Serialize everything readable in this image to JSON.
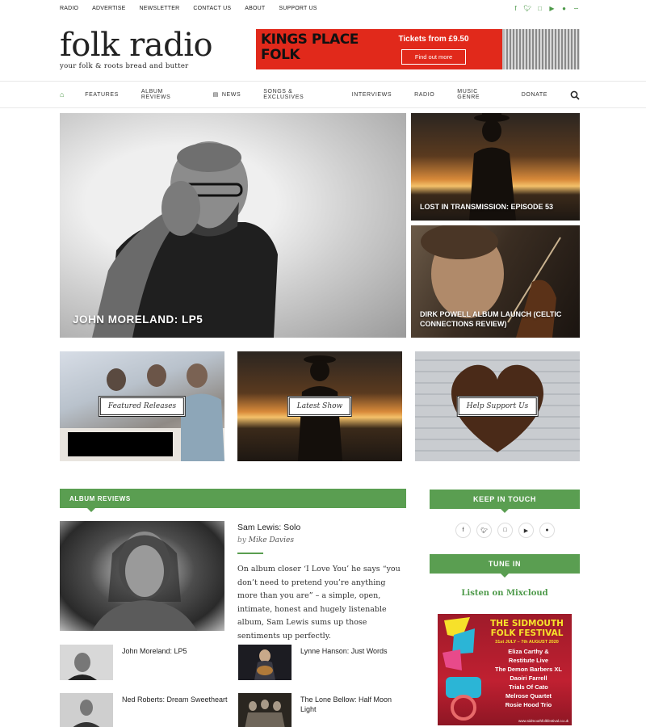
{
  "topbar": {
    "links": [
      "RADIO",
      "ADVERTISE",
      "NEWSLETTER",
      "CONTACT US",
      "ABOUT",
      "SUPPORT US"
    ],
    "social_icons": [
      "facebook-icon",
      "twitter-icon",
      "instagram-icon",
      "youtube-icon",
      "spotify-icon",
      "rss-icon"
    ]
  },
  "logo": {
    "name": "folk radio",
    "tagline": "your folk & roots bread and butter"
  },
  "ad": {
    "brand_line1": "KINGS PLACE",
    "brand_line2": "FOLK",
    "tickets": "Tickets from £9.50",
    "cta": "Find out more",
    "color": "#e1291b"
  },
  "nav": {
    "items": [
      "FEATURES",
      "ALBUM REVIEWS",
      "NEWS",
      "SONGS & EXCLUSIVES",
      "INTERVIEWS",
      "RADIO",
      "MUSIC GENRE",
      "DONATE"
    ],
    "accent": "#4e9a4a"
  },
  "hero": {
    "main": "JOHN MORELAND: LP5",
    "side1": "LOST IN TRANSMISSION: EPISODE 53",
    "side2": "DIRK POWELL ALBUM LAUNCH (CELTIC CONNECTIONS REVIEW)"
  },
  "promos": [
    "Featured Releases",
    "Latest Show",
    "Help Support Us"
  ],
  "album_reviews": {
    "header": "ALBUM REVIEWS",
    "featured": {
      "title": "Sam Lewis: Solo",
      "by": "by",
      "author": "Mike Davies",
      "excerpt": "On album closer ‘I Love You’ he says “you don’t need to pretend you’re anything more than you are” – a simple, open, intimate, honest and hugely listenable album, Sam Lewis sums up those sentiments up perfectly."
    },
    "list": [
      "John Moreland: LP5",
      "Lynne Hanson: Just Words",
      "Ned Roberts: Dream Sweetheart",
      "The Lone Bellow: Half Moon Light"
    ]
  },
  "sidebar": {
    "keep_in_touch": "KEEP IN TOUCH",
    "social_icons": [
      "facebook-icon",
      "twitter-icon",
      "instagram-icon",
      "youtube-icon",
      "spotify-icon"
    ],
    "tune_in": "TUNE IN",
    "mixcloud": "Listen on Mixcloud",
    "festival": {
      "title": "THE SIDMOUTH FOLK FESTIVAL",
      "dates": "31st JULY – 7th AUGUST 2020",
      "acts": [
        "Eliza Carthy &",
        "Restitute Live",
        "The Demon Barbers XL",
        "Daoiri Farrell",
        "Trials Of Cato",
        "Melrose Quartet",
        "Rosie Hood Trio"
      ],
      "url": "www.sidmouthfolkfestival.co.uk"
    }
  }
}
